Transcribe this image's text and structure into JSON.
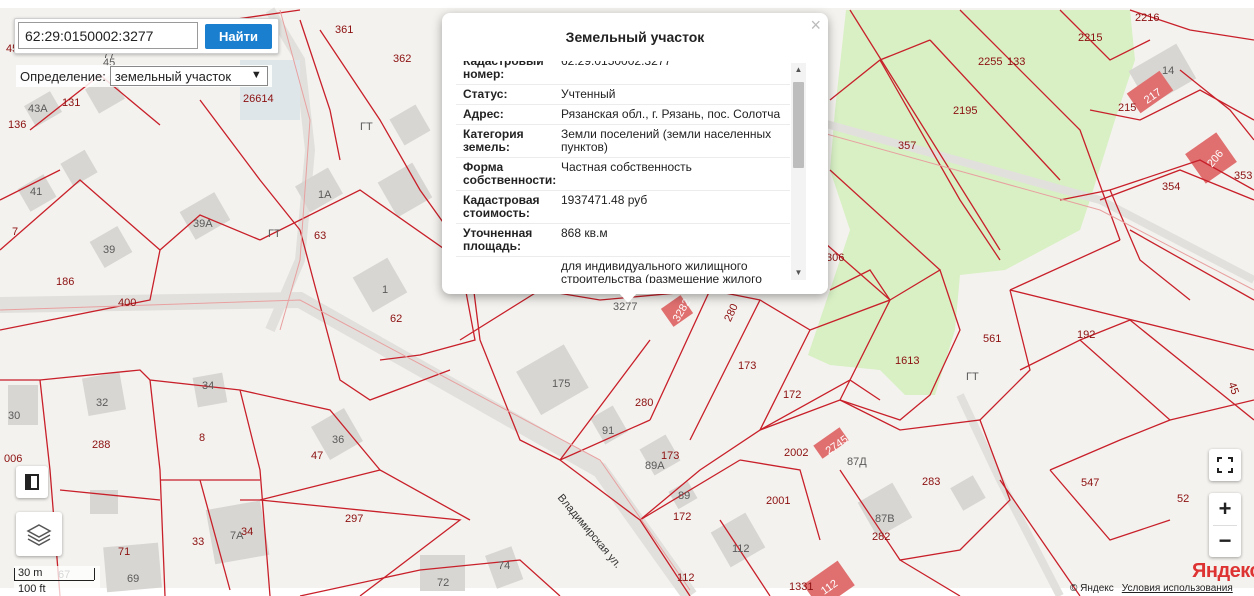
{
  "search": {
    "value": "62:29:0150002:3277",
    "button": "Найти"
  },
  "definition": {
    "label": "Определение:",
    "selected": "земельный участок"
  },
  "popup": {
    "title": "Земельный участок",
    "close": "×",
    "rows": [
      {
        "key": "Кадастровый номер:",
        "value": "62:29:0150002:3277"
      },
      {
        "key": "Статус:",
        "value": "Учтенный"
      },
      {
        "key": "Адрес:",
        "value": "Рязанская обл., г. Рязань, пос. Солотча"
      },
      {
        "key": "Категория земель:",
        "value": "Земли поселений (земли населенных пунктов)"
      },
      {
        "key": "Форма собственности:",
        "value": "Частная собственность"
      },
      {
        "key": "Кадастровая стоимость:",
        "value": "1937471.48 руб"
      },
      {
        "key": "Уточненная площадь:",
        "value": "868 кв.м"
      },
      {
        "key": "",
        "value": "для индивидуального жилищного строительства (размещение жилого дома, не предназначенного для раздела"
      }
    ]
  },
  "map": {
    "parcel_labels": [
      "361",
      "362",
      "26614",
      "131",
      "136",
      "43А",
      "41",
      "7",
      "39",
      "186",
      "400",
      "39А",
      "63",
      "1А",
      "1",
      "62",
      "3277",
      "280",
      "173",
      "172",
      "1613",
      "561",
      "192",
      "357",
      "2195",
      "2255",
      "133",
      "215",
      "2216",
      "14",
      "354",
      "353",
      "306",
      "280",
      "175",
      "91",
      "89А",
      "173",
      "89",
      "172",
      "2001",
      "2002",
      "87Д",
      "283",
      "87В",
      "282",
      "112",
      "1331",
      "547",
      "52",
      "30",
      "32",
      "288",
      "8",
      "34",
      "36",
      "47",
      "297",
      "71",
      "69",
      "33",
      "7А",
      "34",
      "72",
      "74",
      "67",
      "006",
      "45",
      "45",
      "77"
    ],
    "street_label": "Владимирская ул.",
    "tilted_labels": [
      "3282",
      "2745",
      "217",
      "206",
      "112"
    ],
    "marks": [
      "ГТ",
      "ГТ",
      "ГТ"
    ]
  },
  "controls": {
    "fullscreen_icon": "fullscreen-icon",
    "layers_icon": "layers-icon",
    "ruler_icon": "ruler-icon",
    "zoom_in": "+",
    "zoom_out": "−"
  },
  "scale": {
    "metric": "30 m",
    "imperial": "100 ft"
  },
  "footer": {
    "logo": "Яндекс",
    "copyright": "© Яндекс",
    "terms": "Условия использования"
  },
  "colors": {
    "parcel_line": "#c8202a",
    "forest": "#d8f0c4",
    "building": "#d8d6d2",
    "building_highlight": "#e07070",
    "button": "#1a7fcf"
  }
}
